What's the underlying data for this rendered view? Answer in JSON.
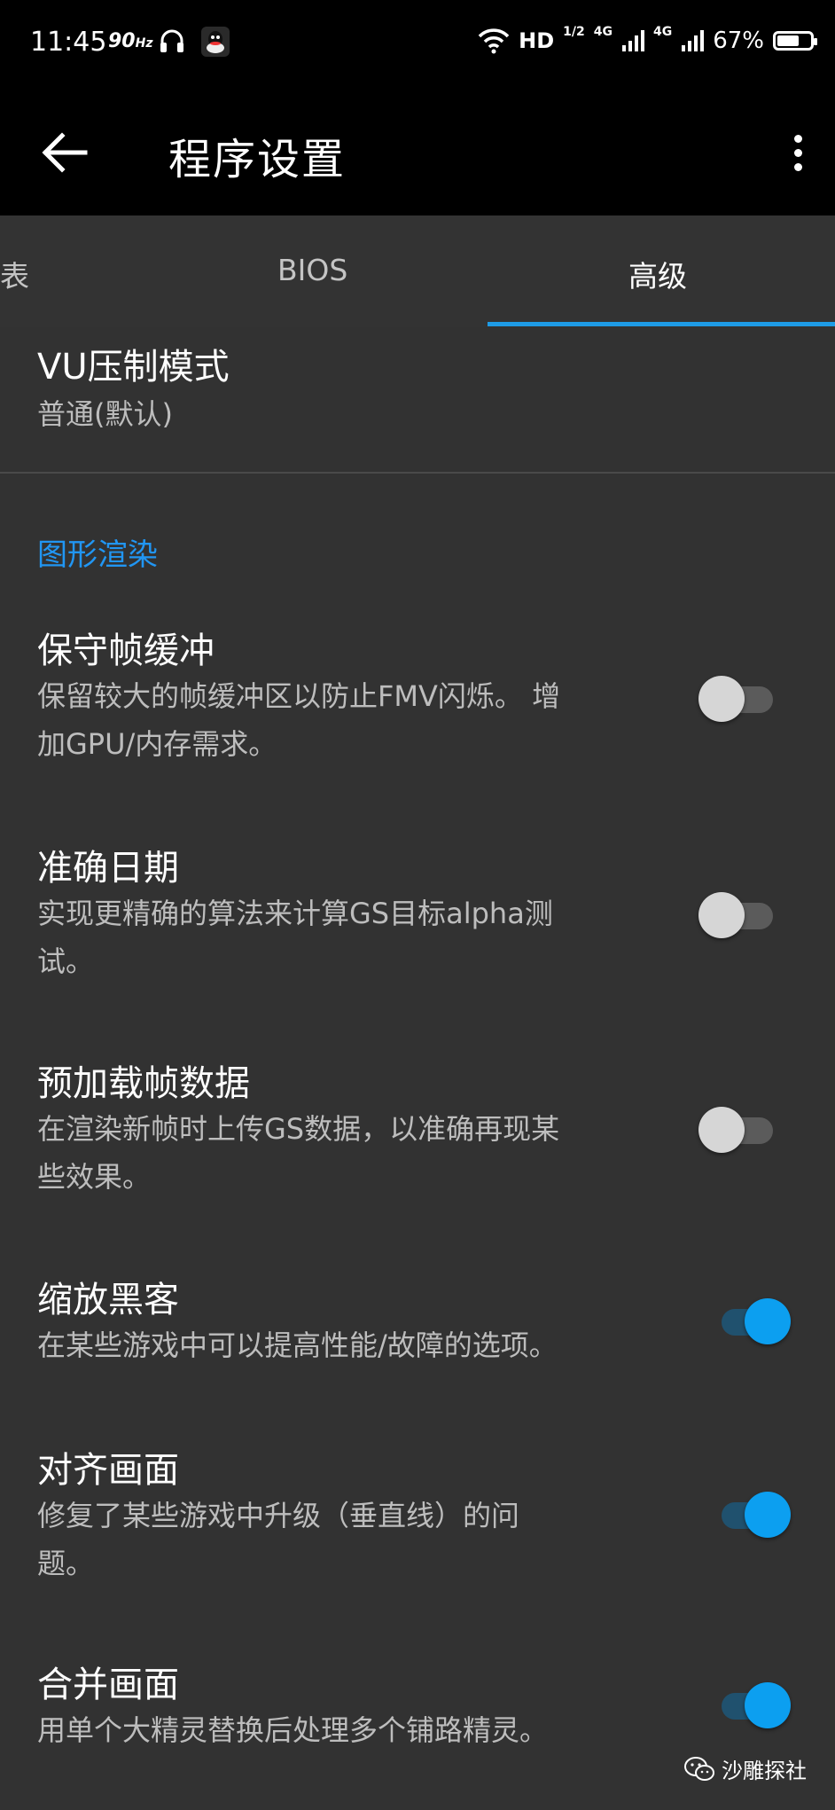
{
  "status_bar": {
    "time": "11:45",
    "refresh_rate": "90",
    "refresh_unit": "Hz",
    "network": "HD",
    "net_sub": "1/2",
    "signal1": "4G",
    "signal2": "4G",
    "battery_percent": "67%",
    "battery_level": 0.67
  },
  "app_bar": {
    "title": "程序设置",
    "back_icon": "arrow-left",
    "menu_icon": "more-vertical"
  },
  "tabs": [
    {
      "label": "表"
    },
    {
      "label": "BIOS"
    },
    {
      "label": "高级",
      "selected": true
    }
  ],
  "vu_pref": {
    "title": "VU压制模式",
    "summary": "普通(默认)"
  },
  "category": {
    "title": "图形渲染",
    "color": "#2196f3"
  },
  "settings": [
    {
      "title": "保守帧缓冲",
      "summary_line1": "保留较大的帧缓冲区以防止FMV闪烁。 增",
      "summary_line2": "加GPU/内存需求。",
      "enabled": false
    },
    {
      "title": "准确日期",
      "summary_line1": "实现更精确的算法来计算GS目标alpha测",
      "summary_line2": "试。",
      "enabled": false
    },
    {
      "title": "预加载帧数据",
      "summary_line1": "在渲染新帧时上传GS数据，以准确再现某",
      "summary_line2": "些效果。",
      "enabled": false
    },
    {
      "title": "缩放黑客",
      "summary_line1": "在某些游戏中可以提高性能/故障的选项。",
      "summary_line2": "",
      "enabled": true
    },
    {
      "title": "对齐画面",
      "summary_line1": "修复了某些游戏中升级（垂直线）的问",
      "summary_line2": "题。",
      "enabled": true
    },
    {
      "title": "合并画面",
      "summary_line1": "用单个大精灵替换后处理多个铺路精灵。",
      "summary_line2": "",
      "enabled": true
    }
  ],
  "watermark": {
    "text": "沙雕探社",
    "icon": "wechat-icon"
  },
  "colors": {
    "accent": "#1e9be6",
    "background": "#323232",
    "switch_on": "#0c9ff0"
  }
}
